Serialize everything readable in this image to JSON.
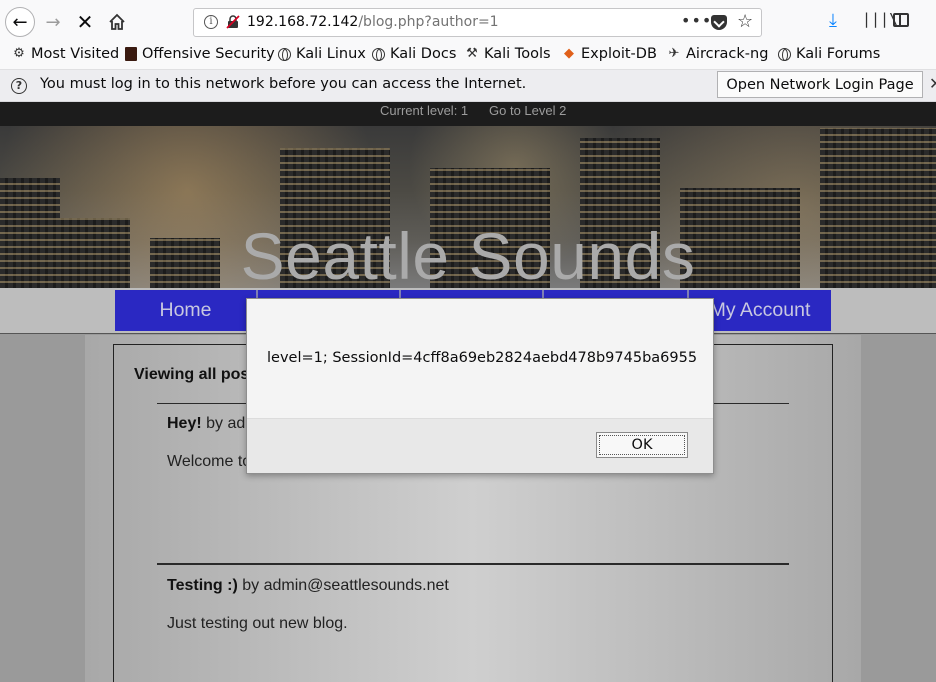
{
  "browser": {
    "url_host": "192.168.72.142",
    "url_path": "/blog.php?author=1",
    "bookmarks": [
      {
        "label": "Most Visited",
        "icon": "gear-icon"
      },
      {
        "label": "Offensive Security",
        "icon": "offsec-icon"
      },
      {
        "label": "Kali Linux",
        "icon": "globe-icon"
      },
      {
        "label": "Kali Docs",
        "icon": "globe-icon"
      },
      {
        "label": "Kali Tools",
        "icon": "kali-tools-icon"
      },
      {
        "label": "Exploit-DB",
        "icon": "exploit-db-icon"
      },
      {
        "label": "Aircrack-ng",
        "icon": "aircrack-icon"
      },
      {
        "label": "Kali Forums",
        "icon": "globe-icon"
      }
    ],
    "notification": {
      "text": "You must log in to this network before you can access the Internet.",
      "button": "Open Network Login Page"
    }
  },
  "page": {
    "level": {
      "current": "Current level: 1",
      "goto": "Go to Level 2"
    },
    "site_title": "Seattle Sounds",
    "nav": [
      "Home",
      "",
      "",
      "",
      "My Account"
    ],
    "nav_color": "#2a28c2",
    "viewing": "Viewing all pos",
    "posts": [
      {
        "title": "Hey!",
        "byline": " by ad",
        "body": "Welcome to"
      },
      {
        "title": "Testing :)",
        "byline": " by admin@seattlesounds.net",
        "body": "Just testing out new blog."
      }
    ]
  },
  "dialog": {
    "message": "level=1; SessionId=4cff8a69eb2824aebd478b9745ba6955",
    "ok": "OK"
  }
}
